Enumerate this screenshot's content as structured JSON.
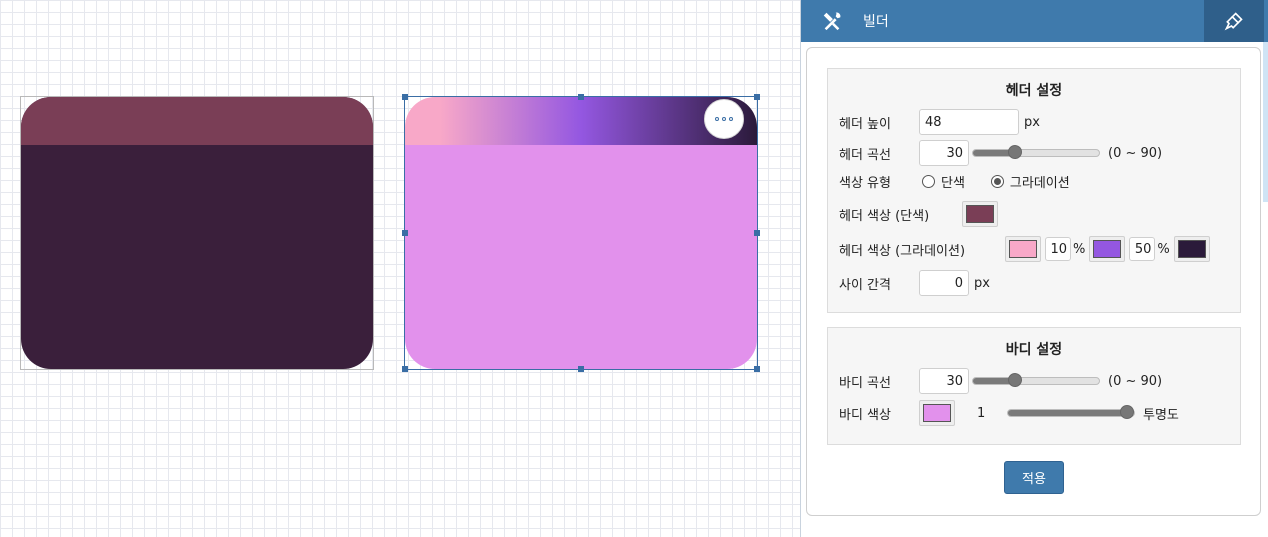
{
  "canvas": {
    "widget1": {
      "header_color": "#7a3e56",
      "body_color": "#3a1f3b"
    },
    "widget2": {
      "header_gradient": [
        "#f8a8c8",
        "#9457e1",
        "#2b1a3a"
      ],
      "body_color": "#e291ec",
      "more_icon": "more-horizontal-icon"
    }
  },
  "panel": {
    "title": "빌더",
    "left_icon": "tools-icon",
    "right_icon": "brush-icon",
    "header_section": {
      "title": "헤더 설정",
      "height_label": "헤더 높이",
      "height_value": "48",
      "height_unit": "px",
      "curve_label": "헤더 곡선",
      "curve_value": "30",
      "curve_range": "(0 ~ 90)",
      "curve_level": 0.333,
      "color_type_label": "색상 유형",
      "radio_solid": "단색",
      "radio_gradient": "그라데이션",
      "selected_color_type": "그라데이션",
      "solid_color_label": "헤더 색상 (단색)",
      "solid_color": "#7a3e56",
      "gradient_label": "헤더 색상 (그라데이션)",
      "gradient_color1": "#f8a8c8",
      "gradient_stop1": "10",
      "gradient_color2": "#9457e1",
      "gradient_stop2": "50",
      "gradient_color3": "#2b1a3a",
      "percent_sign": "%",
      "gap_label": "사이 간격",
      "gap_value": "0",
      "gap_unit": "px"
    },
    "body_section": {
      "title": "바디 설정",
      "curve_label": "바디 곡선",
      "curve_value": "30",
      "curve_range": "(0 ~ 90)",
      "curve_level": 0.333,
      "color_label": "바디 색상",
      "color": "#e291ec",
      "opacity_value": "1",
      "opacity_level": 1.0,
      "opacity_label": "투명도"
    },
    "apply_label": "적용"
  }
}
